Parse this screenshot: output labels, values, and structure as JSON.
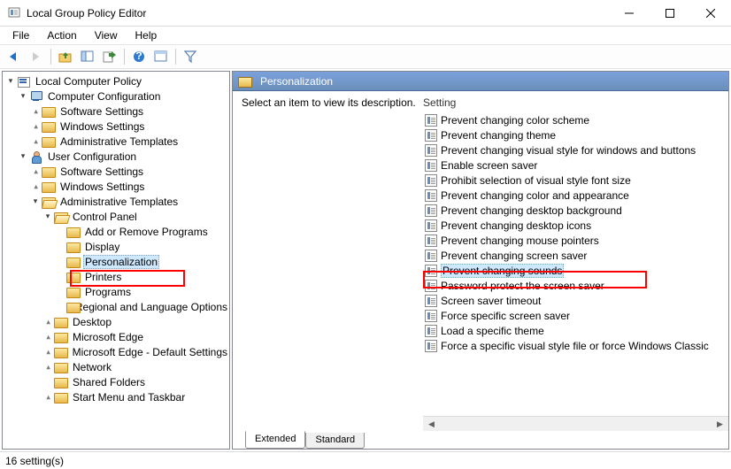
{
  "window": {
    "title": "Local Group Policy Editor"
  },
  "menu": {
    "file": "File",
    "action": "Action",
    "view": "View",
    "help": "Help"
  },
  "tree": {
    "root": "Local Computer Policy",
    "comp_cfg": "Computer Configuration",
    "sw_settings": "Software Settings",
    "win_settings": "Windows Settings",
    "admin_tpl": "Administrative Templates",
    "user_cfg": "User Configuration",
    "ctrl_panel": "Control Panel",
    "add_remove": "Add or Remove Programs",
    "display": "Display",
    "personalization": "Personalization",
    "printers": "Printers",
    "programs": "Programs",
    "regional": "Regional and Language Options",
    "desktop": "Desktop",
    "ms_edge": "Microsoft Edge",
    "ms_edge_def": "Microsoft Edge - Default Settings",
    "network": "Network",
    "shared_folders": "Shared Folders",
    "start_menu": "Start Menu and Taskbar"
  },
  "right": {
    "title": "Personalization",
    "desc_hint": "Select an item to view its description.",
    "col_setting": "Setting",
    "settings": [
      "Prevent changing color scheme",
      "Prevent changing theme",
      "Prevent changing visual style for windows and buttons",
      "Enable screen saver",
      "Prohibit selection of visual style font size",
      "Prevent changing color and appearance",
      "Prevent changing desktop background",
      "Prevent changing desktop icons",
      "Prevent changing mouse pointers",
      "Prevent changing screen saver",
      "Prevent changing sounds",
      "Password protect the screen saver",
      "Screen saver timeout",
      "Force specific screen saver",
      "Load a specific theme",
      "Force a specific visual style file or force Windows Classic"
    ]
  },
  "tabs": {
    "extended": "Extended",
    "standard": "Standard"
  },
  "status": {
    "count": "16 setting(s)"
  }
}
